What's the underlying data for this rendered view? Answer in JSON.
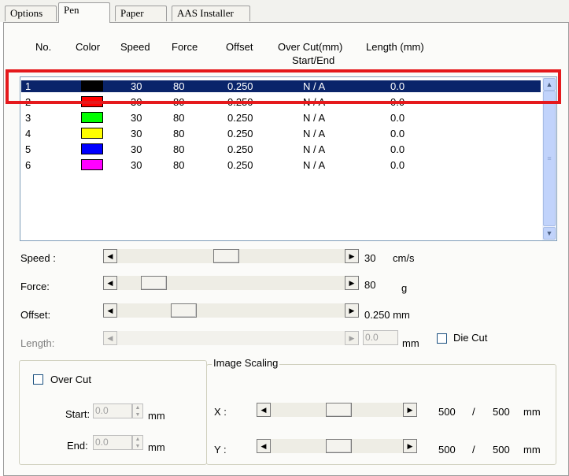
{
  "tabs": [
    {
      "label": "Options"
    },
    {
      "label": "Pen"
    },
    {
      "label": "Paper"
    },
    {
      "label": "AAS Installer"
    }
  ],
  "columns": {
    "no": "No.",
    "color": "Color",
    "speed": "Speed",
    "force": "Force",
    "offset": "Offset",
    "overcut_line1": "Over Cut(mm)",
    "overcut_line2": "Start/End",
    "length": "Length (mm)"
  },
  "pens": [
    {
      "no": "1",
      "color": "#000000",
      "speed": "30",
      "force": "80",
      "offset": "0.250",
      "overcut": "N / A",
      "length": "0.0"
    },
    {
      "no": "2",
      "color": "#ff0000",
      "speed": "30",
      "force": "80",
      "offset": "0.250",
      "overcut": "N / A",
      "length": "0.0"
    },
    {
      "no": "3",
      "color": "#00ff00",
      "speed": "30",
      "force": "80",
      "offset": "0.250",
      "overcut": "N / A",
      "length": "0.0"
    },
    {
      "no": "4",
      "color": "#ffff00",
      "speed": "30",
      "force": "80",
      "offset": "0.250",
      "overcut": "N / A",
      "length": "0.0"
    },
    {
      "no": "5",
      "color": "#0000ff",
      "speed": "30",
      "force": "80",
      "offset": "0.250",
      "overcut": "N / A",
      "length": "0.0"
    },
    {
      "no": "6",
      "color": "#ff00ff",
      "speed": "30",
      "force": "80",
      "offset": "0.250",
      "overcut": "N / A",
      "length": "0.0"
    }
  ],
  "controls": {
    "speed_label": "Speed :",
    "speed_value": "30",
    "speed_unit": "cm/s",
    "force_label": "Force:",
    "force_value": "80",
    "force_unit": "g",
    "offset_label": "Offset:",
    "offset_value": "0.250 mm",
    "length_label": "Length:",
    "length_value": "0.0",
    "length_unit": "mm",
    "diecut_label": "Die Cut"
  },
  "overcut": {
    "checkbox_label": "Over Cut",
    "start_label": "Start:",
    "start_value": "0.0",
    "end_label": "End:",
    "end_value": "0.0",
    "unit": "mm"
  },
  "scaling": {
    "title": "Image Scaling",
    "x_label": "X :",
    "x_value": "500",
    "x_sep": "/",
    "x_total": "500",
    "y_label": "Y :",
    "y_value": "500",
    "y_sep": "/",
    "y_total": "500",
    "unit": "mm"
  },
  "colors": {
    "selection": "#0a246a",
    "highlight_box": "#e5191c"
  }
}
